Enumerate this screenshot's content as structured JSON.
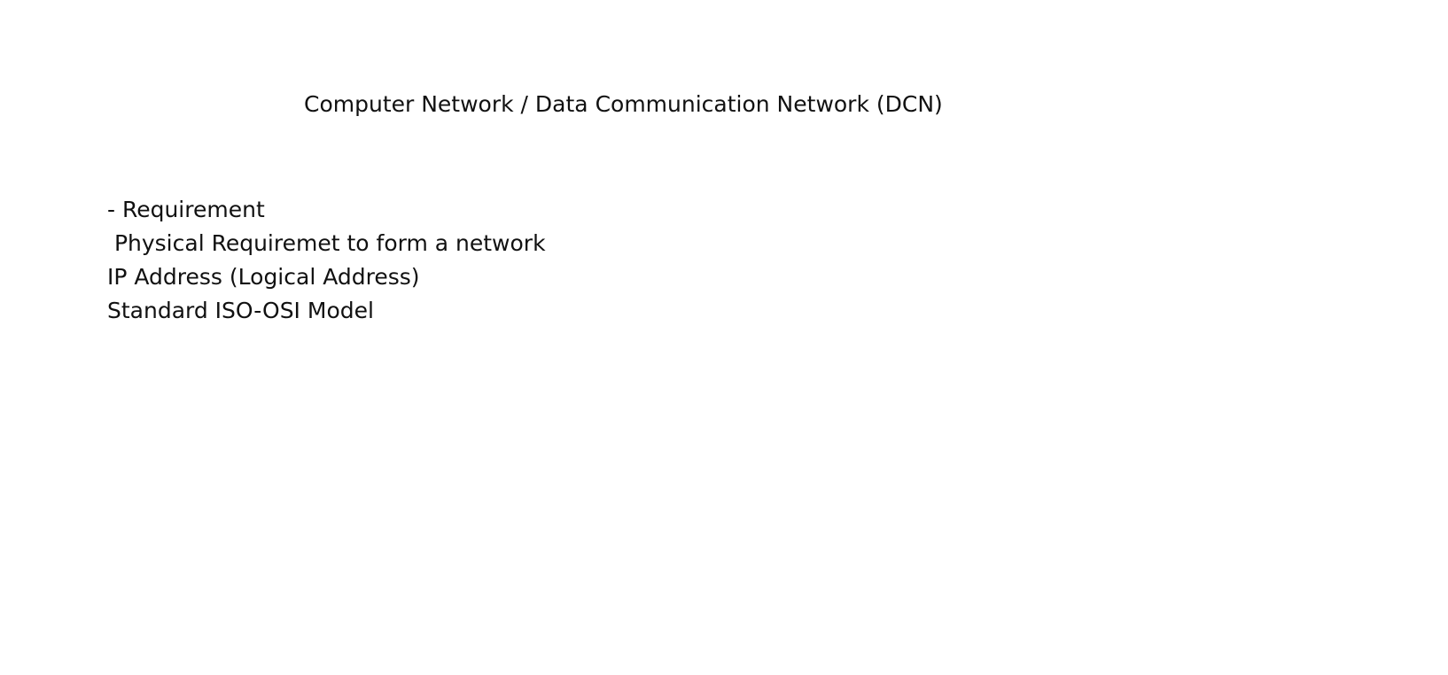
{
  "document": {
    "title": "Computer Network / Data Communication Network (DCN)",
    "lines": [
      "- Requirement",
      " Physical Requiremet to form a network",
      "IP Address (Logical Address)",
      "Standard ISO-OSI Model"
    ]
  }
}
